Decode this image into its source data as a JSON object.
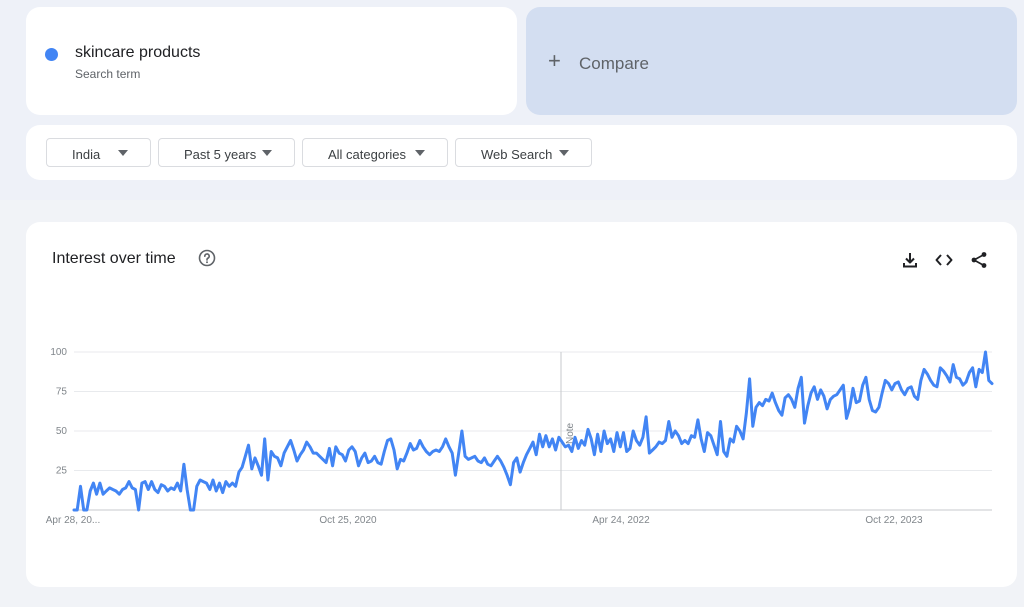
{
  "search_term": {
    "name": "skincare products",
    "subtitle": "Search term",
    "color": "#4285f4"
  },
  "compare": {
    "icon": "plus-icon",
    "label": "Compare"
  },
  "filters": [
    {
      "label": "India"
    },
    {
      "label": "Past 5 years"
    },
    {
      "label": "All categories"
    },
    {
      "label": "Web Search"
    }
  ],
  "chart_panel": {
    "title": "Interest over time",
    "icons": [
      "help-icon",
      "download-icon",
      "embed-code-icon",
      "share-icon"
    ]
  },
  "chart_data": {
    "type": "line",
    "title": "Interest over time",
    "xlabel": "",
    "ylabel": "",
    "ylim": [
      0,
      100
    ],
    "yticks": [
      100,
      75,
      50,
      25
    ],
    "x_tick_labels": [
      "Apr 28, 20...",
      "Oct 25, 2020",
      "Apr 24, 2022",
      "Oct 22, 2023"
    ],
    "annotation": "Note",
    "series": [
      {
        "color": "#4285f4",
        "values": [
          0,
          0,
          15,
          0,
          0,
          12,
          17,
          10,
          17,
          10,
          12,
          14,
          13,
          12,
          10,
          13,
          14,
          18,
          14,
          13,
          0,
          17,
          18,
          13,
          18,
          13,
          11,
          16,
          15,
          12,
          14,
          13,
          17,
          12,
          29,
          13,
          0,
          0,
          15,
          19,
          18,
          17,
          13,
          19,
          12,
          17,
          11,
          18,
          15,
          17,
          15,
          24,
          27,
          34,
          41,
          26,
          33,
          28,
          22,
          45,
          19,
          37,
          34,
          33,
          28,
          36,
          40,
          44,
          38,
          31,
          35,
          38,
          43,
          40,
          36,
          36,
          34,
          32,
          30,
          39,
          28,
          40,
          36,
          35,
          31,
          38,
          40,
          37,
          28,
          33,
          36,
          30,
          31,
          34,
          30,
          29,
          37,
          44,
          45,
          38,
          26,
          32,
          31,
          36,
          42,
          38,
          39,
          44,
          40,
          37,
          35,
          37,
          38,
          37,
          40,
          45,
          40,
          36,
          22,
          36,
          50,
          34,
          32,
          33,
          34,
          31,
          30,
          33,
          29,
          28,
          31,
          34,
          31,
          27,
          22,
          16,
          30,
          33,
          24,
          30,
          35,
          39,
          43,
          35,
          48,
          40,
          47,
          40,
          45,
          38,
          46,
          43,
          40,
          41,
          37,
          46,
          39,
          44,
          41,
          51,
          45,
          35,
          48,
          37,
          50,
          42,
          45,
          37,
          49,
          40,
          49,
          37,
          39,
          50,
          44,
          41,
          46,
          59,
          36,
          38,
          40,
          43,
          42,
          44,
          56,
          46,
          50,
          47,
          42,
          44,
          42,
          47,
          46,
          57,
          45,
          37,
          49,
          47,
          41,
          35,
          56,
          37,
          34,
          45,
          43,
          53,
          50,
          45,
          61,
          83,
          53,
          65,
          68,
          66,
          70,
          69,
          74,
          68,
          63,
          60,
          71,
          73,
          70,
          65,
          77,
          84,
          55,
          66,
          74,
          78,
          70,
          76,
          72,
          64,
          70,
          72,
          73,
          76,
          79,
          58,
          65,
          77,
          68,
          69,
          79,
          84,
          70,
          63,
          62,
          65,
          74,
          82,
          80,
          76,
          80,
          81,
          76,
          73,
          77,
          78,
          72,
          70,
          82,
          89,
          86,
          82,
          79,
          78,
          90,
          88,
          85,
          81,
          92,
          84,
          83,
          79,
          81,
          87,
          90,
          78,
          89,
          87,
          100,
          82,
          80
        ]
      }
    ]
  }
}
